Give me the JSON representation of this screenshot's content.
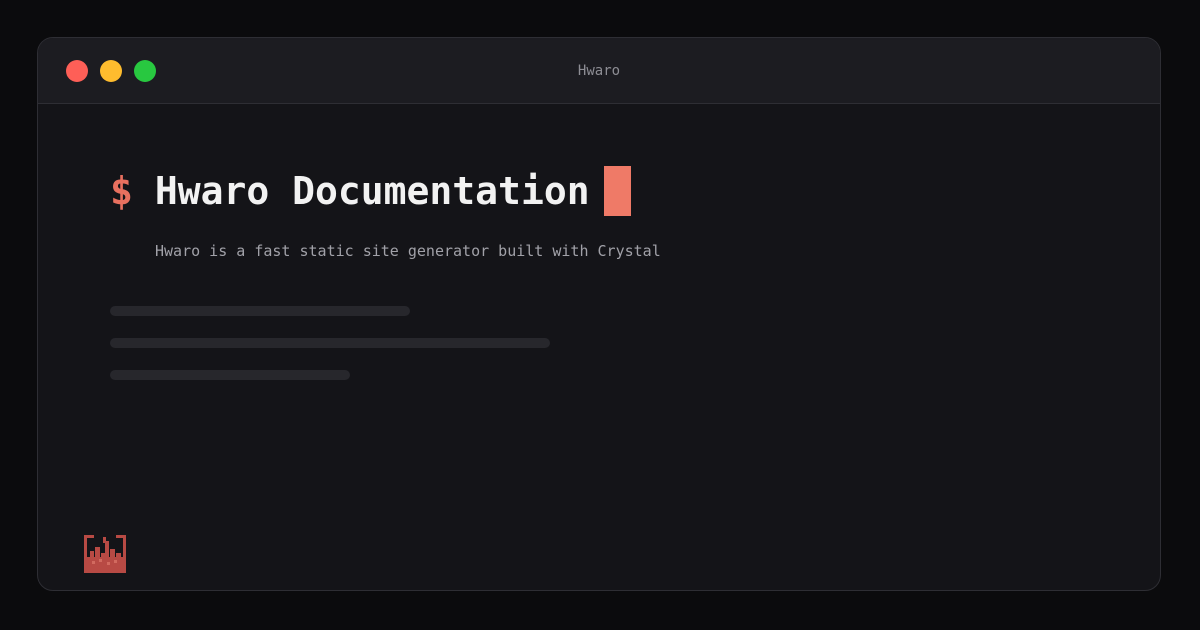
{
  "window": {
    "title": "Hwaro"
  },
  "terminal": {
    "prompt": "$",
    "title": "Hwaro Documentation",
    "subtitle": "Hwaro is a fast static site generator built with Crystal"
  },
  "colors": {
    "accent": "#ef7a67",
    "background": "#141418",
    "titlebar": "#1c1c21",
    "close": "#fe5f57",
    "minimize": "#febc2e",
    "maximize": "#28c840"
  },
  "icons": {
    "logo": "hwaro-castle-logo"
  }
}
